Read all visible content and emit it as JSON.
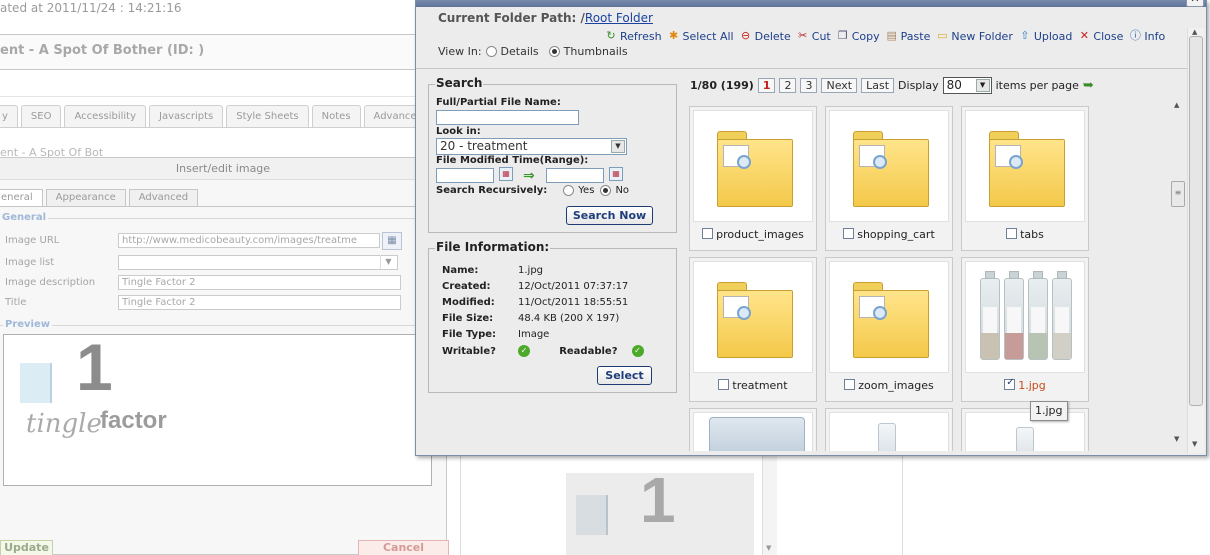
{
  "background": {
    "updated_text": "ated at 2011/11/24 : 14:21:16",
    "page_title": "ent - A Spot Of Bother (ID: )",
    "tabs": [
      "y",
      "SEO",
      "Accessibility",
      "Javascripts",
      "Style Sheets",
      "Notes",
      "Advance"
    ],
    "subtitle": "ent - A Spot Of Bot",
    "colors": {
      "accent": "#1d3f8a",
      "link": "#1a44a0",
      "current_page": "#c41e1e",
      "selected_caption": "#c84b1a"
    }
  },
  "insert_dialog": {
    "title": "Insert/edit image",
    "tabs": [
      "eneral",
      "Appearance",
      "Advanced"
    ],
    "general_legend": "General",
    "fields": {
      "image_url_label": "Image URL",
      "image_url_value": "http://www.medicobeauty.com/images/treatme",
      "image_list_label": "Image list",
      "image_list_value": "",
      "description_label": "Image description",
      "description_value": "Tingle Factor 2",
      "title_label": "Title",
      "title_value": "Tingle Factor 2"
    },
    "preview_legend": "Preview",
    "logo_number": "1",
    "logo_word1": "tingle",
    "logo_word2": "factor",
    "update_label": "Update",
    "cancel_label": "Cancel"
  },
  "file_manager": {
    "path_label": "Current Folder Path: /",
    "path_link": "Root Folder",
    "toolbar": [
      {
        "label": "Refresh",
        "icon": "refresh-icon",
        "glyph": "↻",
        "color": "#3b8f2b"
      },
      {
        "label": "Select All",
        "icon": "select-all-icon",
        "glyph": "✱",
        "color": "#e08a12"
      },
      {
        "label": "Delete",
        "icon": "delete-icon",
        "glyph": "⊖",
        "color": "#c8221e"
      },
      {
        "label": "Cut",
        "icon": "cut-icon",
        "glyph": "✂",
        "color": "#b22"
      },
      {
        "label": "Copy",
        "icon": "copy-icon",
        "glyph": "❐",
        "color": "#557"
      },
      {
        "label": "Paste",
        "icon": "paste-icon",
        "glyph": "📋",
        "color": "#a86"
      },
      {
        "label": "New Folder",
        "icon": "new-folder-icon",
        "glyph": "▭",
        "color": "#d9a92c"
      },
      {
        "label": "Upload",
        "icon": "upload-icon",
        "glyph": "⇧",
        "color": "#2f7fc0"
      },
      {
        "label": "Close",
        "icon": "close-icon",
        "glyph": "✕",
        "color": "#c8221e"
      },
      {
        "label": "Info",
        "icon": "info-icon",
        "glyph": "ⓘ",
        "color": "#2f63b5"
      }
    ],
    "view_in_label": "View In:",
    "view_details": "Details",
    "view_thumbnails": "Thumbnails",
    "search": {
      "legend": "Search",
      "name_label": "Full/Partial File Name:",
      "name_value": "",
      "look_in_label": "Look in:",
      "look_in_value": "20 - treatment",
      "modified_label": "File Modified Time(Range):",
      "recursive_label": "Search Recursively:",
      "yes_label": "Yes",
      "no_label": "No",
      "button": "Search Now"
    },
    "info": {
      "legend": "File Information:",
      "name_k": "Name:",
      "name_v": "1.jpg",
      "created_k": "Created:",
      "created_v": "12/Oct/2011 07:37:17",
      "modified_k": "Modified:",
      "modified_v": "11/Oct/2011 18:55:51",
      "size_k": "File Size:",
      "size_v": "48.4 KB (200 X 197)",
      "type_k": "File Type:",
      "type_v": "Image",
      "writable_k": "Writable?",
      "readable_k": "Readable?",
      "button": "Select"
    },
    "pager": {
      "count": "1/80 (199)",
      "pages": [
        "1",
        "2",
        "3"
      ],
      "next": "Next",
      "last": "Last",
      "display_label": "Display",
      "per_page": "80",
      "per_page_suffix": "items per page"
    },
    "items": [
      {
        "name": "product_images",
        "kind": "folder",
        "checked": false
      },
      {
        "name": "shopping_cart",
        "kind": "folder",
        "checked": false
      },
      {
        "name": "tabs",
        "kind": "folder",
        "checked": false
      },
      {
        "name": "treatment",
        "kind": "folder",
        "checked": false
      },
      {
        "name": "zoom_images",
        "kind": "folder",
        "checked": false
      },
      {
        "name": "1.jpg",
        "kind": "image",
        "checked": true
      }
    ],
    "tooltip": "1.jpg"
  }
}
